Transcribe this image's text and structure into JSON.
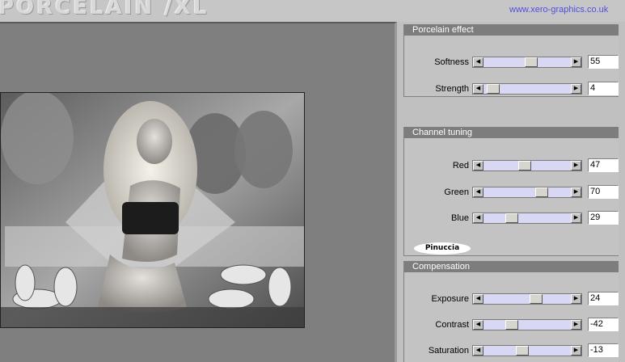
{
  "header": {
    "logo_text": "PORCELAIN /XL",
    "url": "www.xero-graphics.co.uk"
  },
  "preview": {
    "description_label": "preview image"
  },
  "groups": {
    "porcelain": {
      "title": "Porcelain effect",
      "sliders": [
        {
          "label": "Softness",
          "value": "55",
          "fraction": 0.55
        },
        {
          "label": "Strength",
          "value": "4",
          "fraction": 0.04
        }
      ]
    },
    "channel": {
      "title": "Channel tuning",
      "sliders": [
        {
          "label": "Red",
          "value": "47",
          "fraction": 0.47
        },
        {
          "label": "Green",
          "value": "70",
          "fraction": 0.7
        },
        {
          "label": "Blue",
          "value": "29",
          "fraction": 0.29
        }
      ],
      "watermark": "Pinuccia"
    },
    "compensation": {
      "title": "Compensation",
      "sliders": [
        {
          "label": "Exposure",
          "value": "24",
          "fraction": 0.62
        },
        {
          "label": "Contrast",
          "value": "-42",
          "fraction": 0.29
        },
        {
          "label": "Saturation",
          "value": "-13",
          "fraction": 0.435
        }
      ]
    }
  },
  "colors": {
    "slider_track": "#d8d8f4",
    "group_title_bg": "#7d7d7d",
    "url_link": "#5050e0"
  }
}
